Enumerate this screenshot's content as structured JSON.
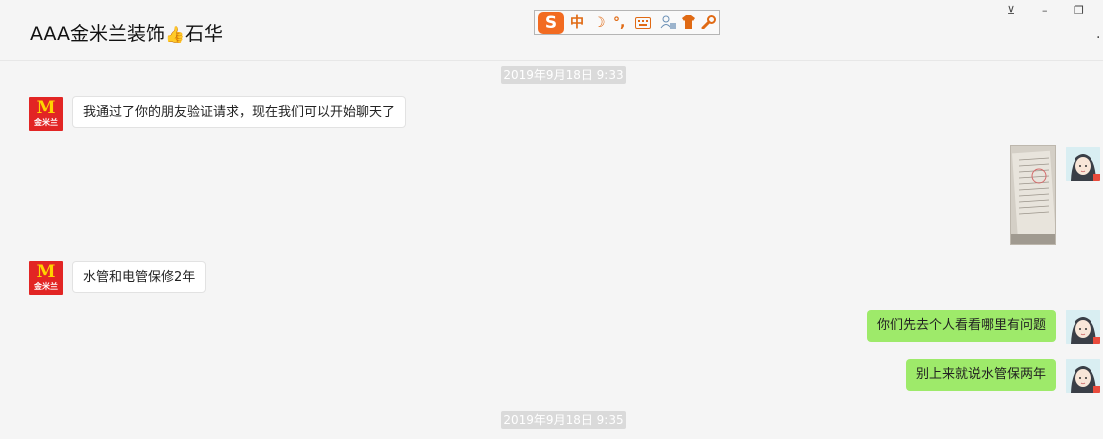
{
  "window": {
    "title_main": "AAA金米兰装饰",
    "title_emoji": "👍",
    "title_suffix": "石华",
    "pin_glyph": "⊻",
    "minimize_glyph": "–",
    "restore_glyph": "❐",
    "more_glyph": "·"
  },
  "ime_toolbar": {
    "logo": "S",
    "mode": "中",
    "moon": "☽",
    "punct": "°,",
    "keyboard_icon": "keyboard-icon",
    "user_icon": "user-icon",
    "shirt_icon": "shirt-icon",
    "wrench_icon": "wrench-icon"
  },
  "avatars": {
    "contact_initial": "M",
    "contact_brand": "金米兰"
  },
  "messages": {
    "timestamp1": "2019年9月18日 9:33",
    "msg1": "我通过了你的朋友验证请求，现在我们可以开始聊天了",
    "msg3": "水管和电管保修2年",
    "msg4": "你们先去个人看看哪里有问题",
    "msg5": "别上来就说水管保两年",
    "timestamp2": "2019年9月18日 9:35"
  },
  "colors": {
    "bubble_sent": "#9eea6a",
    "bubble_received": "#ffffff",
    "brand_red": "#e22524",
    "ime_orange": "#f26b21"
  }
}
